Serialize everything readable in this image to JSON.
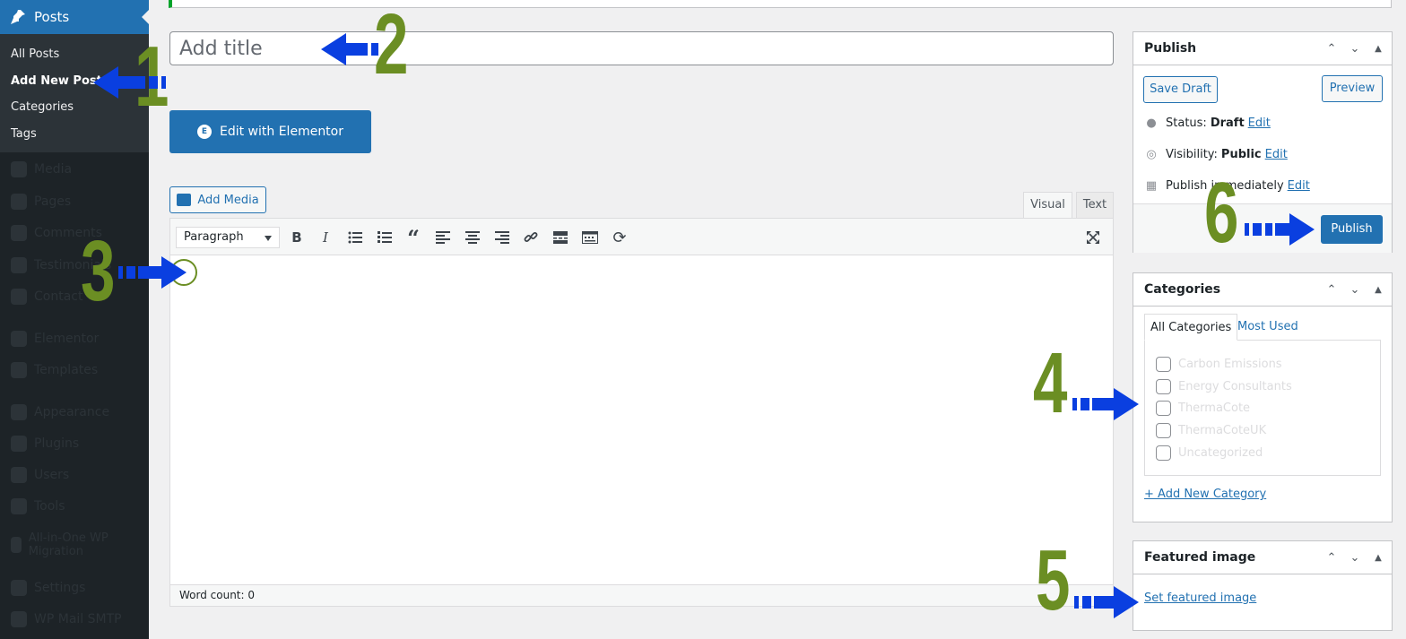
{
  "sidebar": {
    "section_label": "Posts",
    "items": [
      {
        "label": "All Posts"
      },
      {
        "label": "Add New Post"
      },
      {
        "label": "Categories"
      },
      {
        "label": "Tags"
      }
    ],
    "dimmed_menu": [
      {
        "label": "Media"
      },
      {
        "label": "Pages"
      },
      {
        "label": "Comments"
      },
      {
        "label": "Testimonials"
      },
      {
        "label": "Contact"
      },
      {
        "label": "Elementor"
      },
      {
        "label": "Templates"
      },
      {
        "label": "Appearance"
      },
      {
        "label": "Plugins"
      },
      {
        "label": "Users"
      },
      {
        "label": "Tools"
      },
      {
        "label": "All-in-One WP Migration"
      },
      {
        "label": "Settings"
      },
      {
        "label": "WP Mail SMTP"
      }
    ]
  },
  "editor": {
    "title_placeholder": "Add title",
    "elementor_label": "Edit with Elementor",
    "add_media_label": "Add Media",
    "tab_visual": "Visual",
    "tab_text": "Text",
    "format_value": "Paragraph",
    "word_count": "Word count: 0"
  },
  "publish": {
    "title": "Publish",
    "save_draft": "Save Draft",
    "preview": "Preview",
    "status_label": "Status:",
    "status_value": "Draft",
    "visibility_label": "Visibility:",
    "visibility_value": "Public",
    "schedule_label": "Publish immediately",
    "edit_link": "Edit",
    "publish_button": "Publish"
  },
  "categories": {
    "title": "Categories",
    "tab_all": "All Categories",
    "tab_most_used": "Most Used",
    "items": [
      {
        "label": "Carbon Emissions"
      },
      {
        "label": "Energy Consultants"
      },
      {
        "label": "ThermaCote"
      },
      {
        "label": "ThermaCoteUK"
      },
      {
        "label": "Uncategorized"
      }
    ],
    "add_new": "+ Add New Category"
  },
  "featured_image": {
    "title": "Featured image",
    "set_link": "Set featured image"
  },
  "annotations": {
    "numbers": [
      "1",
      "2",
      "3",
      "4",
      "5",
      "6"
    ],
    "number_color": "#6b8e23",
    "arrow_color": "#0a3fe0"
  }
}
